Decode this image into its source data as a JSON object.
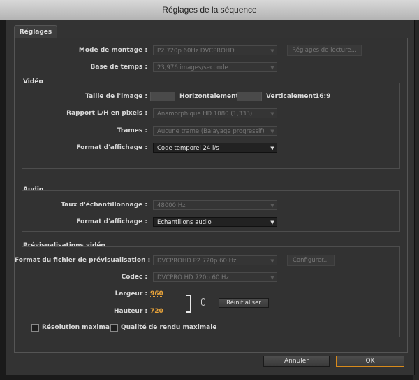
{
  "window": {
    "title": "Réglages de la séquence"
  },
  "tab": {
    "label": "Réglages"
  },
  "general": {
    "edit_mode_label": "Mode de montage :",
    "edit_mode_value": "P2 720p 60Hz DVCPROHD",
    "playback_settings_button": "Réglages de lecture...",
    "timebase_label": "Base de temps :",
    "timebase_value": "23,976 images/seconde"
  },
  "video": {
    "section_label": "Vidéo",
    "frame_size_label": "Taille de l'image :",
    "horizontal_label": "Horizontalement",
    "vertical_label": "Verticalement",
    "aspect_ratio": "16:9",
    "pixel_aspect_label": "Rapport L/H en pixels :",
    "pixel_aspect_value": "Anamorphique HD 1080 (1,333)",
    "fields_label": "Trames :",
    "fields_value": "Aucune trame (Balayage progressif)",
    "display_format_label": "Format d'affichage :",
    "display_format_value": "Code temporel 24 i/s"
  },
  "audio": {
    "section_label": "Audio",
    "sample_rate_label": "Taux d'échantillonnage :",
    "sample_rate_value": "48000 Hz",
    "display_format_label": "Format d'affichage :",
    "display_format_value": "Echantillons audio"
  },
  "preview": {
    "section_label": "Prévisualisations vidéo",
    "file_format_label": "Format du fichier de prévisualisation :",
    "file_format_value": "DVCPROHD P2 720p 60 Hz",
    "configure_button": "Configurer...",
    "codec_label": "Codec :",
    "codec_value": "DVCPRO HD 720p 60 Hz",
    "width_label": "Largeur :",
    "width_value": "960",
    "height_label": "Hauteur :",
    "height_value": "720",
    "reset_button": "Réinitialiser",
    "max_resolution_label": "Résolution maximale",
    "max_quality_label": "Qualité de rendu maximale"
  },
  "footer": {
    "cancel_button": "Annuler",
    "ok_button": "OK"
  },
  "colors": {
    "accent": "#e6a23a",
    "ok_border": "#d88a1b"
  }
}
